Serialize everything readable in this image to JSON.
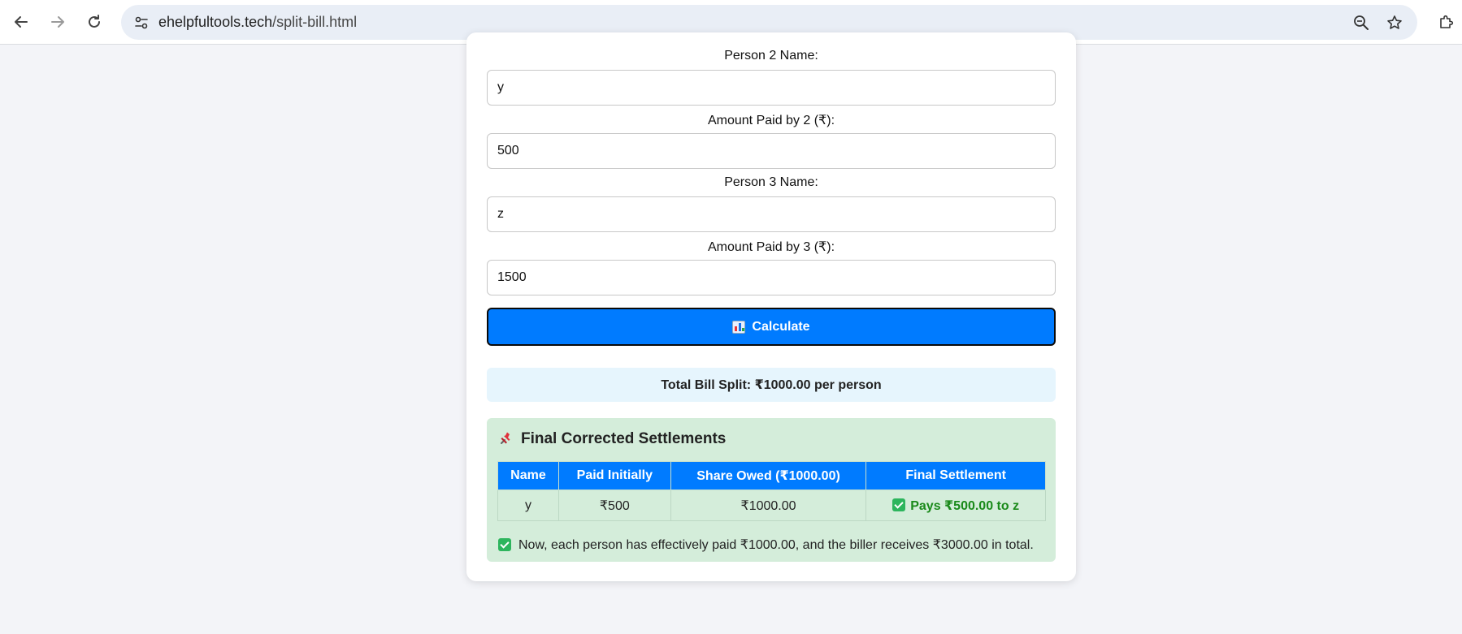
{
  "browser": {
    "url_domain": "ehelpfultools.tech",
    "url_path": "/split-bill.html"
  },
  "form": {
    "person2_label": "Person 2 Name:",
    "person2_value": "y",
    "amount2_label": "Amount Paid by 2 (₹):",
    "amount2_value": "500",
    "person3_label": "Person 3 Name:",
    "person3_value": "z",
    "amount3_label": "Amount Paid by 3 (₹):",
    "amount3_value": "1500",
    "calculate_label": "Calculate"
  },
  "summary": {
    "text": "Total Bill Split: ₹1000.00 per person"
  },
  "settlements": {
    "title": "Final Corrected Settlements",
    "columns": [
      "Name",
      "Paid Initially",
      "Share Owed (₹1000.00)",
      "Final Settlement"
    ],
    "rows": [
      {
        "name": "y",
        "paid": "₹500",
        "share": "₹1000.00",
        "final": "Pays ₹500.00 to z"
      }
    ],
    "note": "Now, each person has effectively paid ₹1000.00, and the biller receives ₹3000.00 in total."
  },
  "icons": {
    "back": "arrow-left-icon",
    "forward": "arrow-right-icon",
    "reload": "reload-icon",
    "site_info": "tune-icon",
    "zoom": "zoom-out-icon",
    "bookmark": "star-icon",
    "extensions": "puzzle-icon",
    "calculate": "bar-chart-icon",
    "settlement_title": "pushpin-icon",
    "check": "checkbox-check-icon"
  },
  "colors": {
    "primary": "#007bff",
    "summary_bg": "#e6f5fd",
    "settlement_bg": "#d4edda",
    "success_text": "#1a8a1a"
  }
}
